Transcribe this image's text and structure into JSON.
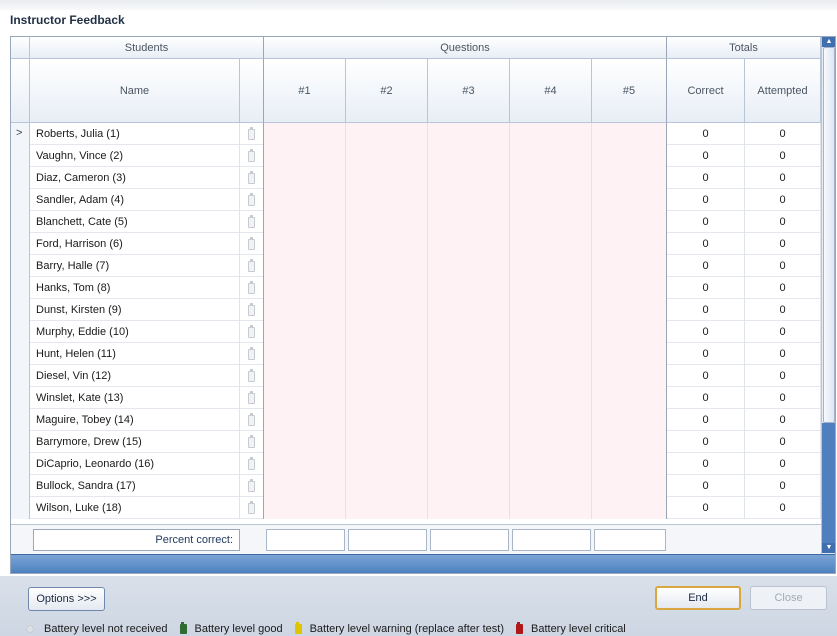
{
  "window": {
    "title": "Instructor Feedback"
  },
  "grid": {
    "groups": {
      "students": "Students",
      "questions": "Questions",
      "totals": "Totals"
    },
    "columns": {
      "name": "Name",
      "q1": "#1",
      "q2": "#2",
      "q3": "#3",
      "q4": "#4",
      "q5": "#5",
      "correct": "Correct",
      "attempted": "Attempted"
    },
    "rows": [
      {
        "name": "Roberts, Julia (1)",
        "correct": "0",
        "attempted": "0"
      },
      {
        "name": "Vaughn, Vince (2)",
        "correct": "0",
        "attempted": "0"
      },
      {
        "name": "Diaz, Cameron (3)",
        "correct": "0",
        "attempted": "0"
      },
      {
        "name": "Sandler, Adam (4)",
        "correct": "0",
        "attempted": "0"
      },
      {
        "name": "Blanchett, Cate (5)",
        "correct": "0",
        "attempted": "0"
      },
      {
        "name": "Ford, Harrison (6)",
        "correct": "0",
        "attempted": "0"
      },
      {
        "name": "Barry, Halle (7)",
        "correct": "0",
        "attempted": "0"
      },
      {
        "name": "Hanks, Tom (8)",
        "correct": "0",
        "attempted": "0"
      },
      {
        "name": "Dunst, Kirsten (9)",
        "correct": "0",
        "attempted": "0"
      },
      {
        "name": "Murphy, Eddie (10)",
        "correct": "0",
        "attempted": "0"
      },
      {
        "name": "Hunt, Helen (11)",
        "correct": "0",
        "attempted": "0"
      },
      {
        "name": "Diesel, Vin (12)",
        "correct": "0",
        "attempted": "0"
      },
      {
        "name": "Winslet, Kate (13)",
        "correct": "0",
        "attempted": "0"
      },
      {
        "name": "Maguire, Tobey (14)",
        "correct": "0",
        "attempted": "0"
      },
      {
        "name": "Barrymore, Drew (15)",
        "correct": "0",
        "attempted": "0"
      },
      {
        "name": "DiCaprio, Leonardo (16)",
        "correct": "0",
        "attempted": "0"
      },
      {
        "name": "Bullock, Sandra (17)",
        "correct": "0",
        "attempted": "0"
      },
      {
        "name": "Wilson, Luke (18)",
        "correct": "0",
        "attempted": "0"
      }
    ],
    "current_row_marker": ">",
    "percent_correct_label": "Percent correct:"
  },
  "footer": {
    "options_label": "Options >>>",
    "end_label": "End",
    "close_label": "Close"
  },
  "legend": {
    "not_received": "Battery level not received",
    "good": "Battery level good",
    "warning": "Battery level warning (replace after test)",
    "critical": "Battery level critical"
  },
  "colors": {
    "question_cell_bg": "#fff2f4",
    "battery_good": "#2f6b33",
    "battery_warning": "#e0c400",
    "battery_critical": "#b01818",
    "end_button_border": "#d9a640"
  },
  "icons": {
    "battery": "battery-icon",
    "row_pointer": "current-row-pointer-icon"
  }
}
